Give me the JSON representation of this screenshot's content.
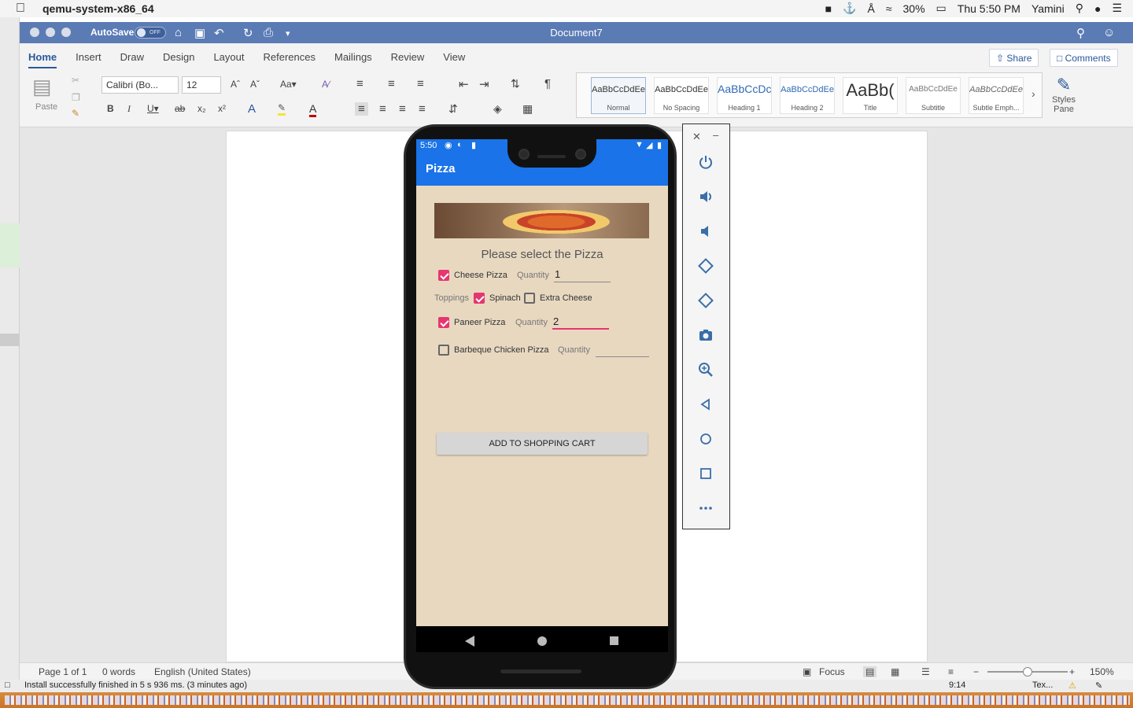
{
  "menubar": {
    "app_name": "qemu-system-x86_64",
    "battery": "30%",
    "clock": "Thu 5:50 PM",
    "user": "Yamini"
  },
  "word": {
    "autosave_label": "AutoSave",
    "autosave_state": "OFF",
    "document_title": "Document7",
    "tabs": [
      "Home",
      "Insert",
      "Draw",
      "Design",
      "Layout",
      "References",
      "Mailings",
      "Review",
      "View"
    ],
    "active_tab": "Home",
    "share_label": "Share",
    "comments_label": "Comments",
    "paste_label": "Paste",
    "font_name": "Calibri (Bo...",
    "font_size": "12",
    "styles": [
      {
        "sample": "AaBbCcDdEe",
        "name": "Normal"
      },
      {
        "sample": "AaBbCcDdEe",
        "name": "No Spacing"
      },
      {
        "sample": "AaBbCcDc",
        "name": "Heading 1"
      },
      {
        "sample": "AaBbCcDdEe",
        "name": "Heading 2"
      },
      {
        "sample": "AaBb(",
        "name": "Title"
      },
      {
        "sample": "AaBbCcDdEe",
        "name": "Subtitle"
      },
      {
        "sample": "AaBbCcDdEe",
        "name": "Subtle Emph..."
      }
    ],
    "styles_pane_label": "Styles Pane",
    "status": {
      "page": "Page 1 of 1",
      "words": "0 words",
      "language": "English (United States)",
      "focus": "Focus",
      "zoom": "150%",
      "zoom_fraction": 0.5
    }
  },
  "bottom_status": {
    "message": "Install successfully finished in 5 s 936 ms. (3 minutes ago)",
    "time": "9:14",
    "right_text": "Tex..."
  },
  "phone": {
    "status_time": "5:50",
    "app_title": "Pizza",
    "heading": "Please select the Pizza",
    "cheese_pizza": {
      "label": "Cheese Pizza",
      "checked": true,
      "qty_hint": "Quantity",
      "qty": "1"
    },
    "toppings_label": "Toppings",
    "spinach": {
      "label": "Spinach",
      "checked": true
    },
    "extra_cheese": {
      "label": "Extra Cheese",
      "checked": false
    },
    "paneer_pizza": {
      "label": "Paneer Pizza",
      "checked": true,
      "qty_hint": "Quantity",
      "qty": "2"
    },
    "bbq_pizza": {
      "label": "Barbeque Chicken Pizza",
      "checked": false,
      "qty_hint": "Quantity",
      "qty": ""
    },
    "cart_button": "ADD TO  SHOPPING CART"
  },
  "emulator_panel": {
    "icons": [
      "power-icon",
      "volume-up-icon",
      "volume-down-icon",
      "rotate-left-icon",
      "rotate-right-icon",
      "camera-icon",
      "zoom-icon",
      "back-icon",
      "home-icon",
      "overview-icon",
      "more-icon"
    ]
  }
}
